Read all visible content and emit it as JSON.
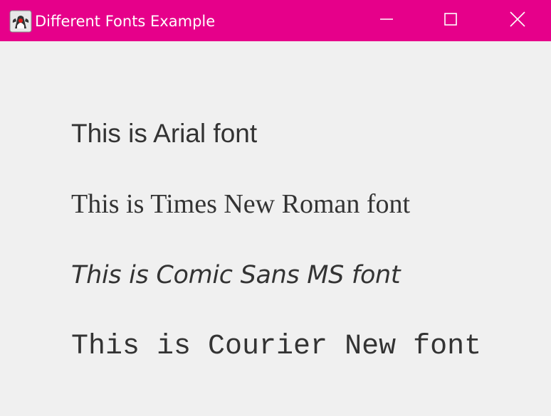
{
  "window": {
    "title": "Different Fonts Example",
    "titlebar_color": "#e6008a",
    "background_color": "#f0f0f0",
    "app_icon": "java-duke-icon",
    "controls": {
      "minimize_icon": "minimize-icon",
      "maximize_icon": "maximize-icon",
      "close_icon": "close-icon"
    }
  },
  "labels": [
    {
      "text": "This is Arial font"
    },
    {
      "text": "This is Times New Roman font"
    },
    {
      "text": "This is Comic Sans MS font"
    },
    {
      "text": "This is Courier New font"
    }
  ],
  "text_color": "#333333"
}
